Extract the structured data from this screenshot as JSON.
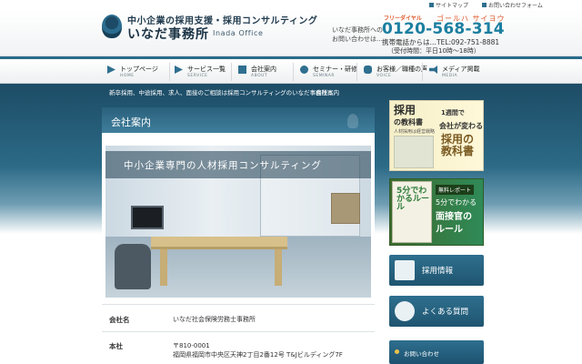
{
  "utility": {
    "sitemap": "サイトマップ",
    "contact_form": "お問い合わせフォーム"
  },
  "header": {
    "tagline": "中小企業の採用支援・採用コンサルティング",
    "name": "いなだ事務所",
    "name_en": "Inada Office",
    "inquiry_line1": "いなだ事務所への",
    "inquiry_line2": "お問い合わせは…",
    "free_dial": "フリーダイヤル",
    "tel_kana": "ゴールハ サイヨウ",
    "tel_free": "0120-568-314",
    "tel_mobile": "携帯電話からは…TEL:092-751-8881",
    "hours": "（受付時間：平日10時〜18時）"
  },
  "nav": {
    "items": [
      {
        "ja": "トップページ",
        "en": "HOME"
      },
      {
        "ja": "サービス一覧",
        "en": "SERVICE"
      },
      {
        "ja": "会社案内",
        "en": "ABOUT"
      },
      {
        "ja": "セミナー・研修",
        "en": "SEMINAR"
      },
      {
        "ja": "お客様／職種の声",
        "en": "VOICE"
      },
      {
        "ja": "メディア掲載",
        "en": "MEDIA"
      }
    ]
  },
  "breadcrumb": {
    "text": "新卒採用、中途採用、求人、面接のご相談は採用コンサルティングのいなだ事務所へ",
    "current": "会社案内"
  },
  "main": {
    "title": "会社案内",
    "hero_caption": "中小企業専門の人材採用コンサルティング",
    "rows": [
      {
        "key": "会社名",
        "value": "いなだ社会保険労務士事務所"
      },
      {
        "key": "本社",
        "value": "〒810-0001",
        "value2": "福岡県福岡市中央区天神2丁目2番12号 T&Jビルディング7F"
      }
    ]
  },
  "sidebar": {
    "book": {
      "title1": "採用",
      "title2": "の教科書",
      "sub": "人材採用は経営戦略",
      "r1": "1週間で",
      "r2": "会社が変わる",
      "big1": "採用の",
      "big2": "教科書"
    },
    "report": {
      "title": "5分でわかるルール",
      "tag": "無料レポート",
      "l1": "5分でわかる",
      "l2": "面接官の",
      "l3": "ルール"
    },
    "recruit_label": "採用情報",
    "faq_label": "よくある質問",
    "contact_label": "お問い合わせ"
  },
  "colors": {
    "brand": "#2a6b8b",
    "accent": "#1b7fa0",
    "tel_kana": "#e0572a"
  }
}
